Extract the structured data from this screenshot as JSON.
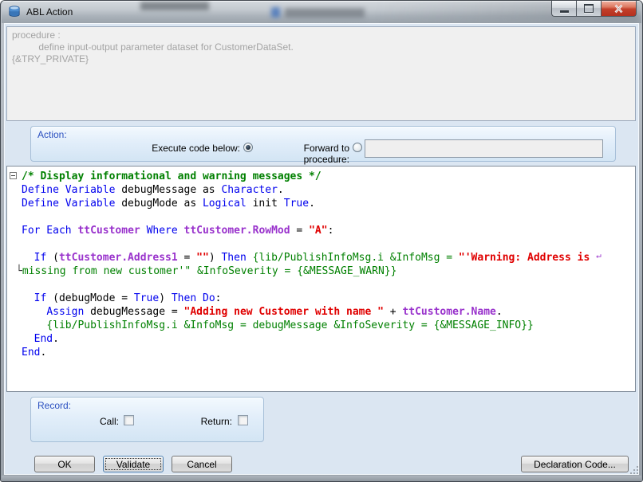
{
  "window": {
    "title": "ABL Action",
    "controls": {
      "minimize": "minimize",
      "maximize": "maximize",
      "close": "close"
    }
  },
  "description": {
    "lines": [
      "procedure :",
      "          define input-output parameter dataset for CustomerDataSet.",
      "{&TRY_PRIVATE}"
    ]
  },
  "action": {
    "label": "Action:",
    "execute_label": "Execute code below:",
    "execute_selected": true,
    "forward_label": "Forward to procedure:",
    "forward_selected": false,
    "forward_value": ""
  },
  "code": {
    "lines": [
      {
        "fold": true,
        "segs": [
          {
            "c": "c",
            "t": "/* Display informational and warning messages */"
          }
        ]
      },
      {
        "segs": [
          {
            "c": "k",
            "t": "Define Variable"
          },
          {
            "c": "p",
            "t": " debugMessage as "
          },
          {
            "c": "k",
            "t": "Character"
          },
          {
            "c": "p",
            "t": "."
          }
        ]
      },
      {
        "segs": [
          {
            "c": "k",
            "t": "Define Variable"
          },
          {
            "c": "p",
            "t": " debugMode as "
          },
          {
            "c": "k",
            "t": "Logical"
          },
          {
            "c": "p",
            "t": " init "
          },
          {
            "c": "k",
            "t": "True"
          },
          {
            "c": "p",
            "t": "."
          }
        ]
      },
      {
        "segs": []
      },
      {
        "segs": [
          {
            "c": "k",
            "t": "For Each"
          },
          {
            "c": "p",
            "t": " "
          },
          {
            "c": "t",
            "t": "ttCustomer"
          },
          {
            "c": "p",
            "t": " "
          },
          {
            "c": "k",
            "t": "Where"
          },
          {
            "c": "p",
            "t": " "
          },
          {
            "c": "t",
            "t": "ttCustomer.RowMod"
          },
          {
            "c": "p",
            "t": " = "
          },
          {
            "c": "s",
            "t": "\"A\""
          },
          {
            "c": "p",
            "t": ":"
          }
        ]
      },
      {
        "segs": []
      },
      {
        "segs": [
          {
            "c": "p",
            "t": "  "
          },
          {
            "c": "k",
            "t": "If"
          },
          {
            "c": "p",
            "t": " ("
          },
          {
            "c": "t",
            "t": "ttCustomer.Address1"
          },
          {
            "c": "p",
            "t": " = "
          },
          {
            "c": "s",
            "t": "\"\""
          },
          {
            "c": "p",
            "t": ") "
          },
          {
            "c": "k",
            "t": "Then"
          },
          {
            "c": "p",
            "t": " "
          },
          {
            "c": "g",
            "t": "{lib/PublishInfoMsg.i &InfoMsg = "
          },
          {
            "c": "s",
            "t": "\"'Warning: Address is "
          },
          {
            "c": "w",
            "t": "↵"
          }
        ]
      },
      {
        "segs": [
          {
            "c": "n",
            "t": "└"
          },
          {
            "c": "g",
            "t": "missing from new customer'\" &InfoSeverity = {&MESSAGE_WARN}}"
          }
        ]
      },
      {
        "segs": []
      },
      {
        "segs": [
          {
            "c": "p",
            "t": "  "
          },
          {
            "c": "k",
            "t": "If"
          },
          {
            "c": "p",
            "t": " (debugMode = "
          },
          {
            "c": "k",
            "t": "True"
          },
          {
            "c": "p",
            "t": ") "
          },
          {
            "c": "k",
            "t": "Then Do"
          },
          {
            "c": "p",
            "t": ":"
          }
        ]
      },
      {
        "segs": [
          {
            "c": "p",
            "t": "    "
          },
          {
            "c": "k",
            "t": "Assign"
          },
          {
            "c": "p",
            "t": " debugMessage = "
          },
          {
            "c": "s",
            "t": "\"Adding new Customer with name \""
          },
          {
            "c": "p",
            "t": " + "
          },
          {
            "c": "t",
            "t": "ttCustomer.Name"
          },
          {
            "c": "p",
            "t": "."
          }
        ]
      },
      {
        "segs": [
          {
            "c": "p",
            "t": "    "
          },
          {
            "c": "g",
            "t": "{lib/PublishInfoMsg.i &InfoMsg = debugMessage &InfoSeverity = {&MESSAGE_INFO}}"
          }
        ]
      },
      {
        "segs": [
          {
            "c": "p",
            "t": "  "
          },
          {
            "c": "k",
            "t": "End"
          },
          {
            "c": "p",
            "t": "."
          }
        ]
      },
      {
        "segs": [
          {
            "c": "k",
            "t": "End"
          },
          {
            "c": "p",
            "t": "."
          }
        ]
      }
    ]
  },
  "record": {
    "label": "Record:",
    "call_label": "Call:",
    "call_checked": false,
    "return_label": "Return:",
    "return_checked": false
  },
  "buttons": {
    "ok": "OK",
    "validate": "Validate",
    "cancel": "Cancel",
    "declaration": "Declaration Code..."
  },
  "syntax_colors": {
    "keyword": "#0000ee",
    "table_field": "#9932cc",
    "string": "#e00000",
    "comment": "#008000",
    "preprocessor": "#008000",
    "group_label": "#2b50c0"
  }
}
